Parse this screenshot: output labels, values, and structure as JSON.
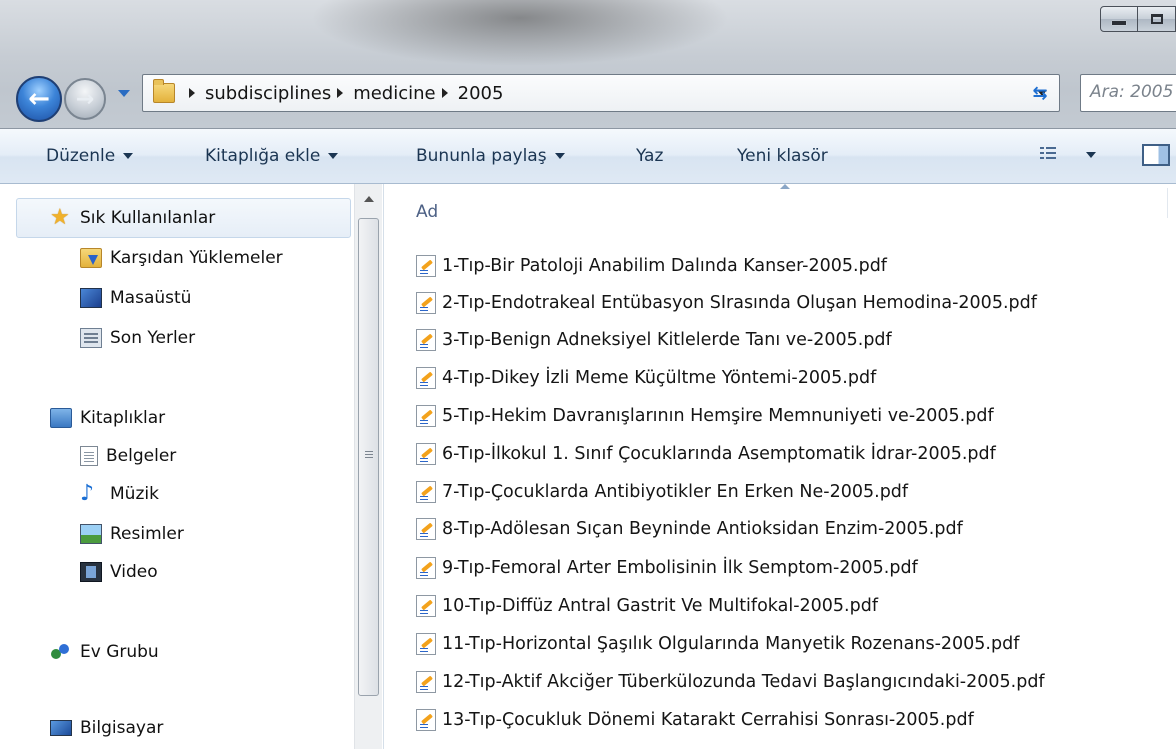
{
  "address": {
    "crumbs": [
      "subdisciplines",
      "medicine",
      "2005"
    ],
    "search_placeholder": "Ara: 2005"
  },
  "toolbar": {
    "organize": "Düzenle",
    "include_in_library": "Kitaplığa ekle",
    "share_with": "Bununla paylaş",
    "burn": "Yaz",
    "new_folder": "Yeni klasör"
  },
  "nav": {
    "favorites": "Sık Kullanılanlar",
    "downloads": "Karşıdan Yüklemeler",
    "desktop": "Masaüstü",
    "recent": "Son Yerler",
    "libraries": "Kitaplıklar",
    "documents": "Belgeler",
    "music": "Müzik",
    "pictures": "Resimler",
    "videos": "Video",
    "homegroup": "Ev Grubu",
    "computer": "Bilgisayar"
  },
  "content": {
    "column_name": "Ad",
    "files": [
      "1-Tıp-Bir Patoloji Anabilim Dalında Kanser-2005.pdf",
      "2-Tıp-Endotrakeal Entübasyon SIrasında Oluşan Hemodina-2005.pdf",
      "3-Tıp-Benign Adneksiyel Kitlelerde Tanı ve-2005.pdf",
      "4-Tıp-Dikey İzli Meme Küçültme Yöntemi-2005.pdf",
      "5-Tıp-Hekim Davranışlarının Hemşire Memnuniyeti ve-2005.pdf",
      "6-Tıp-İlkokul 1. Sınıf Çocuklarında Asemptomatik İdrar-2005.pdf",
      "7-Tıp-Çocuklarda Antibiyotikler En Erken Ne-2005.pdf",
      "8-Tıp-Adölesan Sıçan Beyninde Antioksidan Enzim-2005.pdf",
      "9-Tıp-Femoral Arter Embolisinin İlk Semptom-2005.pdf",
      "10-Tıp-Diffüz Antral Gastrit Ve Multifokal-2005.pdf",
      "11-Tıp-Horizontal Şaşılık Olgularında Manyetik Rozenans-2005.pdf",
      "12-Tıp-Aktif Akciğer Tüberkülozunda Tedavi Başlangıcındaki-2005.pdf",
      "13-Tıp-Çocukluk Dönemi Katarakt Cerrahisi Sonrası-2005.pdf"
    ]
  }
}
